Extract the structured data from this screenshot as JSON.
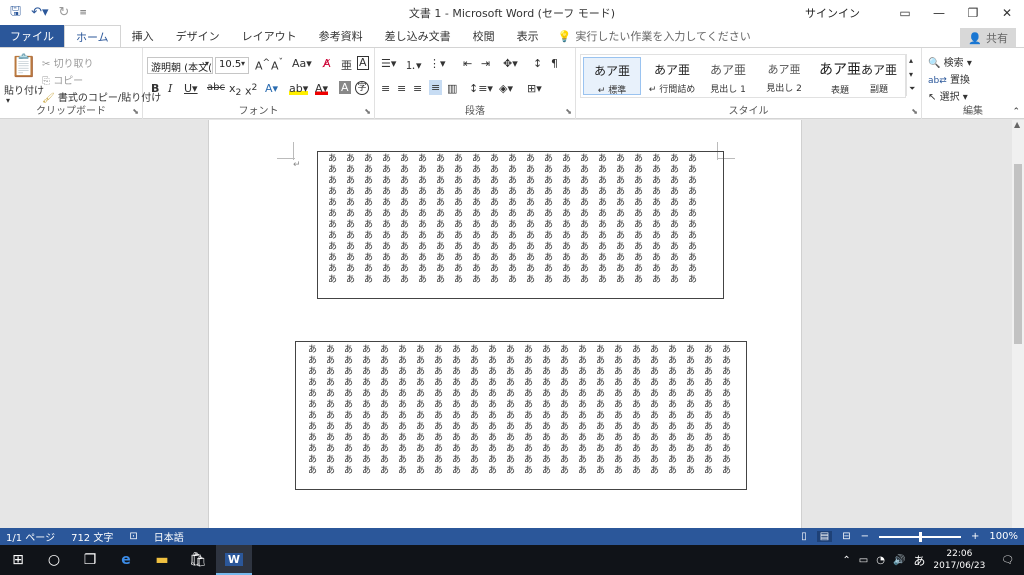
{
  "titlebar": {
    "title": "文書 1  -  Microsoft Word (セーフ モード)",
    "signin": "サインイン"
  },
  "tabs": [
    "ファイル",
    "ホーム",
    "挿入",
    "デザイン",
    "レイアウト",
    "参考資料",
    "差し込み文書",
    "校閲",
    "表示"
  ],
  "tell_me": "実行したい作業を入力してください",
  "share": "共有",
  "clipboard": {
    "paste": "貼り付け",
    "cut": "切り取り",
    "copy": "コピー",
    "format_painter": "書式のコピー/貼り付け",
    "label": "クリップボード"
  },
  "font": {
    "name": "游明朝 (本文(",
    "size": "10.5",
    "label": "フォント"
  },
  "paragraph": {
    "label": "段落"
  },
  "styles": {
    "items": [
      {
        "sample": "あア亜",
        "name": "↵ 標準"
      },
      {
        "sample": "あア亜",
        "name": "↵ 行間詰め"
      },
      {
        "sample": "あア亜",
        "name": "見出し 1"
      },
      {
        "sample": "あア亜",
        "name": "見出し 2"
      },
      {
        "sample": "あア亜",
        "name": "表題"
      },
      {
        "sample": "あア亜",
        "name": "副題"
      }
    ],
    "label": "スタイル"
  },
  "editing": {
    "find": "検索",
    "replace": "置換",
    "select": "選択",
    "label": "編集"
  },
  "document": {
    "char": "あ",
    "frame1": {
      "rows": 12,
      "cols": 21
    },
    "frame2": {
      "rows": 12,
      "cols": 24
    }
  },
  "status": {
    "page": "1/1 ページ",
    "words": "712 文字",
    "language": "日本語",
    "zoom": "100%"
  },
  "taskbar": {
    "time": "22:06",
    "date": "2017/06/23",
    "ime": "あ"
  }
}
